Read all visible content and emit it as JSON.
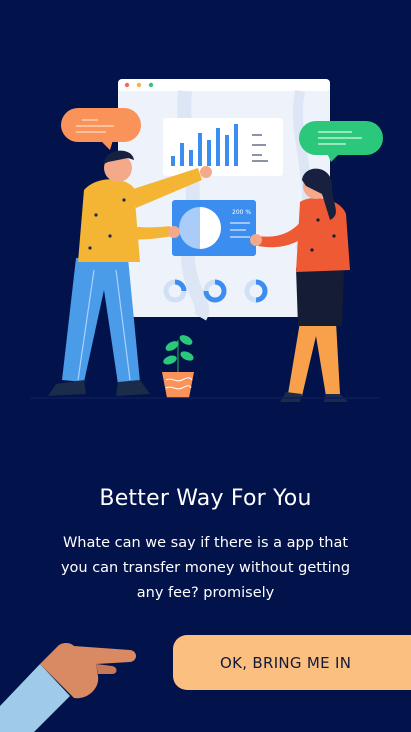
{
  "onboarding": {
    "title": "Better Way For You",
    "description": "Whate can we say if there is a app that you can transfer money without getting any fee? promisely",
    "cta_label": "OK, BRING ME IN"
  },
  "illustration": {
    "stat_label": "200 %"
  },
  "colors": {
    "background": "#02124a",
    "accent": "#fbc07f",
    "bubble_orange": "#f9935a",
    "bubble_green": "#2bc77a",
    "chart_blue": "#3c8df0"
  }
}
